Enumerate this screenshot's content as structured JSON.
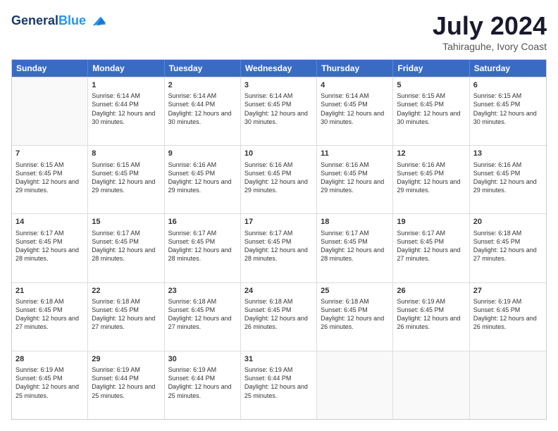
{
  "header": {
    "logo_line1": "General",
    "logo_line2": "Blue",
    "month": "July 2024",
    "location": "Tahiraguhe, Ivory Coast"
  },
  "days_of_week": [
    "Sunday",
    "Monday",
    "Tuesday",
    "Wednesday",
    "Thursday",
    "Friday",
    "Saturday"
  ],
  "weeks": [
    [
      {
        "day": "",
        "empty": true
      },
      {
        "day": "1",
        "sunrise": "6:14 AM",
        "sunset": "6:44 PM",
        "daylight": "12 hours and 30 minutes."
      },
      {
        "day": "2",
        "sunrise": "6:14 AM",
        "sunset": "6:44 PM",
        "daylight": "12 hours and 30 minutes."
      },
      {
        "day": "3",
        "sunrise": "6:14 AM",
        "sunset": "6:45 PM",
        "daylight": "12 hours and 30 minutes."
      },
      {
        "day": "4",
        "sunrise": "6:14 AM",
        "sunset": "6:45 PM",
        "daylight": "12 hours and 30 minutes."
      },
      {
        "day": "5",
        "sunrise": "6:15 AM",
        "sunset": "6:45 PM",
        "daylight": "12 hours and 30 minutes."
      },
      {
        "day": "6",
        "sunrise": "6:15 AM",
        "sunset": "6:45 PM",
        "daylight": "12 hours and 30 minutes."
      }
    ],
    [
      {
        "day": "7",
        "sunrise": "6:15 AM",
        "sunset": "6:45 PM",
        "daylight": "12 hours and 29 minutes."
      },
      {
        "day": "8",
        "sunrise": "6:15 AM",
        "sunset": "6:45 PM",
        "daylight": "12 hours and 29 minutes."
      },
      {
        "day": "9",
        "sunrise": "6:16 AM",
        "sunset": "6:45 PM",
        "daylight": "12 hours and 29 minutes."
      },
      {
        "day": "10",
        "sunrise": "6:16 AM",
        "sunset": "6:45 PM",
        "daylight": "12 hours and 29 minutes."
      },
      {
        "day": "11",
        "sunrise": "6:16 AM",
        "sunset": "6:45 PM",
        "daylight": "12 hours and 29 minutes."
      },
      {
        "day": "12",
        "sunrise": "6:16 AM",
        "sunset": "6:45 PM",
        "daylight": "12 hours and 29 minutes."
      },
      {
        "day": "13",
        "sunrise": "6:16 AM",
        "sunset": "6:45 PM",
        "daylight": "12 hours and 29 minutes."
      }
    ],
    [
      {
        "day": "14",
        "sunrise": "6:17 AM",
        "sunset": "6:45 PM",
        "daylight": "12 hours and 28 minutes."
      },
      {
        "day": "15",
        "sunrise": "6:17 AM",
        "sunset": "6:45 PM",
        "daylight": "12 hours and 28 minutes."
      },
      {
        "day": "16",
        "sunrise": "6:17 AM",
        "sunset": "6:45 PM",
        "daylight": "12 hours and 28 minutes."
      },
      {
        "day": "17",
        "sunrise": "6:17 AM",
        "sunset": "6:45 PM",
        "daylight": "12 hours and 28 minutes."
      },
      {
        "day": "18",
        "sunrise": "6:17 AM",
        "sunset": "6:45 PM",
        "daylight": "12 hours and 28 minutes."
      },
      {
        "day": "19",
        "sunrise": "6:17 AM",
        "sunset": "6:45 PM",
        "daylight": "12 hours and 27 minutes."
      },
      {
        "day": "20",
        "sunrise": "6:18 AM",
        "sunset": "6:45 PM",
        "daylight": "12 hours and 27 minutes."
      }
    ],
    [
      {
        "day": "21",
        "sunrise": "6:18 AM",
        "sunset": "6:45 PM",
        "daylight": "12 hours and 27 minutes."
      },
      {
        "day": "22",
        "sunrise": "6:18 AM",
        "sunset": "6:45 PM",
        "daylight": "12 hours and 27 minutes."
      },
      {
        "day": "23",
        "sunrise": "6:18 AM",
        "sunset": "6:45 PM",
        "daylight": "12 hours and 27 minutes."
      },
      {
        "day": "24",
        "sunrise": "6:18 AM",
        "sunset": "6:45 PM",
        "daylight": "12 hours and 26 minutes."
      },
      {
        "day": "25",
        "sunrise": "6:18 AM",
        "sunset": "6:45 PM",
        "daylight": "12 hours and 26 minutes."
      },
      {
        "day": "26",
        "sunrise": "6:19 AM",
        "sunset": "6:45 PM",
        "daylight": "12 hours and 26 minutes."
      },
      {
        "day": "27",
        "sunrise": "6:19 AM",
        "sunset": "6:45 PM",
        "daylight": "12 hours and 26 minutes."
      }
    ],
    [
      {
        "day": "28",
        "sunrise": "6:19 AM",
        "sunset": "6:45 PM",
        "daylight": "12 hours and 25 minutes."
      },
      {
        "day": "29",
        "sunrise": "6:19 AM",
        "sunset": "6:44 PM",
        "daylight": "12 hours and 25 minutes."
      },
      {
        "day": "30",
        "sunrise": "6:19 AM",
        "sunset": "6:44 PM",
        "daylight": "12 hours and 25 minutes."
      },
      {
        "day": "31",
        "sunrise": "6:19 AM",
        "sunset": "6:44 PM",
        "daylight": "12 hours and 25 minutes."
      },
      {
        "day": "",
        "empty": true
      },
      {
        "day": "",
        "empty": true
      },
      {
        "day": "",
        "empty": true
      }
    ]
  ]
}
